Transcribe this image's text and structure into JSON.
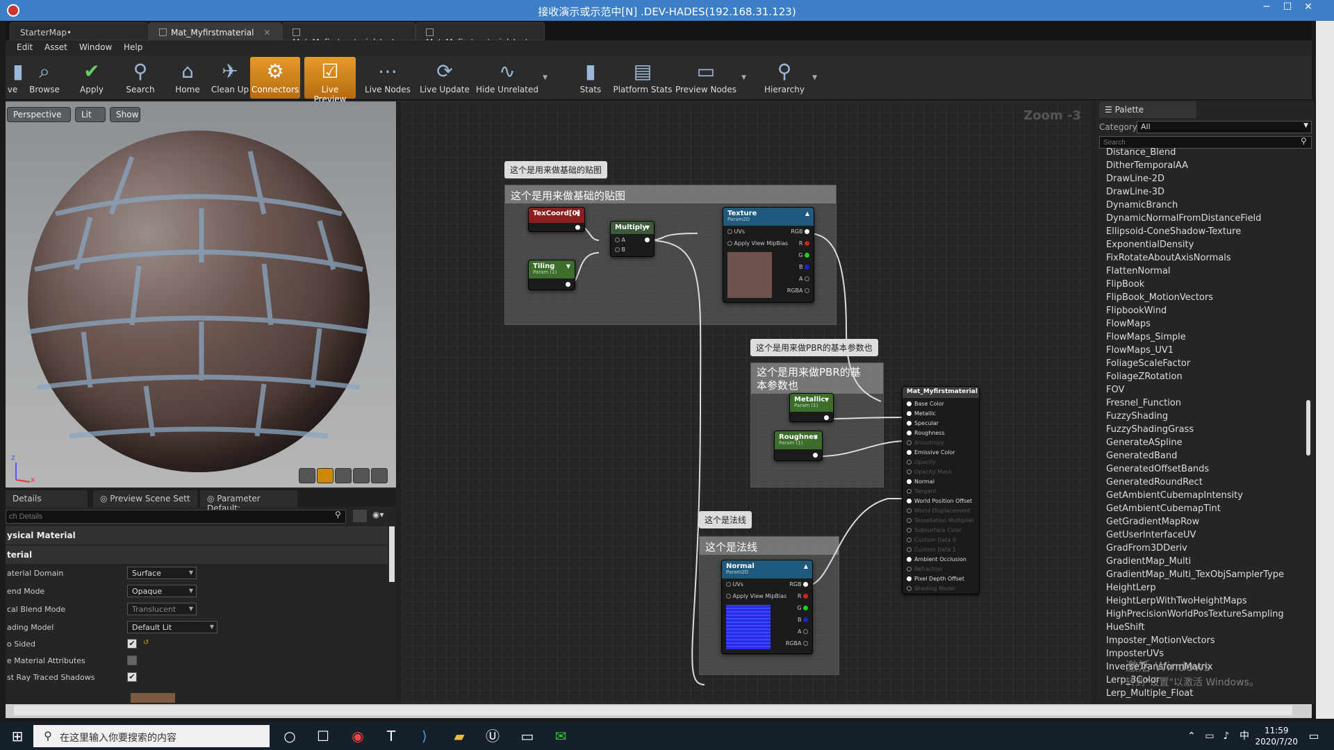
{
  "window": {
    "title": "接收演示或示范中[N] .DEV-HADES(192.168.31.123)",
    "min": "─",
    "max": "☐",
    "close": "✕"
  },
  "tabs": [
    {
      "label": "StarterMap•"
    },
    {
      "label": "Mat_Myfirstmaterial"
    },
    {
      "label": "Mat_Myfirstmaterial_Inst"
    },
    {
      "label": "Mat_Myfirstmaterial_Inst•"
    }
  ],
  "menu": [
    "Edit",
    "Asset",
    "Window",
    "Help"
  ],
  "toolbar": [
    {
      "label": "ve",
      "icon": "save-icon"
    },
    {
      "label": "Browse",
      "icon": "browse-icon"
    },
    {
      "label": "Apply",
      "icon": "apply-check-icon"
    },
    {
      "label": "Search",
      "icon": "search-icon"
    },
    {
      "label": "Home",
      "icon": "home-icon"
    },
    {
      "label": "Clean Up",
      "icon": "cleanup-icon"
    },
    {
      "label": "Connectors",
      "icon": "connectors-icon",
      "active": true
    },
    {
      "label": "Live Preview",
      "icon": "live-preview-icon",
      "active": true
    },
    {
      "label": "Live Nodes",
      "icon": "live-nodes-icon"
    },
    {
      "label": "Live Update",
      "icon": "live-update-icon"
    },
    {
      "label": "Hide Unrelated",
      "icon": "hide-unrelated-icon"
    },
    {
      "label": "Stats",
      "icon": "stats-icon"
    },
    {
      "label": "Platform Stats",
      "icon": "platform-stats-icon"
    },
    {
      "label": "Preview Nodes",
      "icon": "preview-nodes-icon"
    },
    {
      "label": "Hierarchy",
      "icon": "hierarchy-icon"
    }
  ],
  "viewport": {
    "perspective": "Perspective",
    "lit": "Lit",
    "show": "Show",
    "axis_z": "z",
    "axis_x": "x"
  },
  "details": {
    "tabs": [
      "Details",
      "Preview Scene Sett",
      "Parameter Default:"
    ],
    "search_placeholder": "ch Details",
    "cat_physical": "ysical Material",
    "cat_material": "terial",
    "rows": [
      {
        "label": "aterial Domain",
        "value": "Surface"
      },
      {
        "label": "end Mode",
        "value": "Opaque"
      },
      {
        "label": "cal Blend Mode",
        "value": "Translucent"
      },
      {
        "label": "ading Model",
        "value": "Default Lit"
      },
      {
        "label": "o Sided"
      },
      {
        "label": "e Material Attributes"
      },
      {
        "label": "st Ray Traced Shadows"
      }
    ]
  },
  "graph": {
    "zoom": "Zoom -3",
    "comment1": {
      "bubble": "这个是用来做基础的贴图",
      "header": "这个是用来做基础的贴图"
    },
    "comment2": {
      "bubble": "这个是用来做PBR的基本参数也",
      "header_l1": "这个是用来做PBR的基",
      "header_l2": "本参数也"
    },
    "comment3": {
      "bubble": "这个是法线",
      "header": "这个是法线"
    },
    "texcoord": "TexCoord[0]",
    "multiply": "Multiply",
    "mult_a": "A",
    "mult_b": "B",
    "tiling": "Tiling",
    "tiling_sub": "Param (1)",
    "texture": "Texture",
    "texture_sub": "Param2D",
    "uvs": "UVs",
    "apply_mip": "Apply View MipBias",
    "rgb": "RGB",
    "r": "R",
    "g": "G",
    "b": "B",
    "a": "A",
    "rgba": "RGBA",
    "metallic": "Metallic",
    "metallic_sub": "Param (1)",
    "roughness": "Roughnes",
    "roughness_sub": "Param (1)",
    "normal": "Normal",
    "normal_sub": "Param2D",
    "result": "Mat_Myfirstmaterial",
    "result_pins": [
      {
        "label": "Base Color",
        "on": true
      },
      {
        "label": "Metallic",
        "on": true
      },
      {
        "label": "Specular",
        "on": true
      },
      {
        "label": "Roughness",
        "on": true
      },
      {
        "label": "Anisotropy",
        "on": false
      },
      {
        "label": "Emissive Color",
        "on": true
      },
      {
        "label": "Opacity",
        "on": false
      },
      {
        "label": "Opacity Mask",
        "on": false
      },
      {
        "label": "Normal",
        "on": true
      },
      {
        "label": "Tangent",
        "on": false
      },
      {
        "label": "World Position Offset",
        "on": true
      },
      {
        "label": "World Displacement",
        "on": false
      },
      {
        "label": "Tessellation Multiplier",
        "on": false
      },
      {
        "label": "Subsurface Color",
        "on": false
      },
      {
        "label": "Custom Data 0",
        "on": false
      },
      {
        "label": "Custom Data 1",
        "on": false
      },
      {
        "label": "Ambient Occlusion",
        "on": true
      },
      {
        "label": "Refraction",
        "on": false
      },
      {
        "label": "Pixel Depth Offset",
        "on": true
      },
      {
        "label": "Shading Model",
        "on": false
      }
    ]
  },
  "palette": {
    "tab": "Palette",
    "category_label": "Category",
    "category_value": "All",
    "search_placeholder": "Search",
    "items": [
      "Distance_Blend",
      "DitherTemporalAA",
      "DrawLine-2D",
      "DrawLine-3D",
      "DynamicBranch",
      "DynamicNormalFromDistanceField",
      "Ellipsoid-ConeShadow-Texture",
      "ExponentialDensity",
      "FixRotateAboutAxisNormals",
      "FlattenNormal",
      "FlipBook",
      "FlipBook_MotionVectors",
      "FlipbookWind",
      "FlowMaps",
      "FlowMaps_Simple",
      "FlowMaps_UV1",
      "FoliageScaleFactor",
      "FoliageZRotation",
      "FOV",
      "Fresnel_Function",
      "FuzzyShading",
      "FuzzyShadingGrass",
      "GenerateASpline",
      "GeneratedBand",
      "GeneratedOffsetBands",
      "GeneratedRoundRect",
      "GetAmbientCubemapIntensity",
      "GetAmbientCubemapTint",
      "GetGradientMapRow",
      "GetUserInterfaceUV",
      "GradFrom3DDeriv",
      "GradientMap_Multi",
      "GradientMap_Multi_TexObjSamplerType",
      "HeightLerp",
      "HeightLerpWithTwoHeightMaps",
      "HighPrecisionWorldPosTextureSampling",
      "HueShift",
      "Imposter_MotionVectors",
      "ImposterUVs",
      "InverseTransformMatrix",
      "Lerp_3Color",
      "Lerp_Multiple_Float"
    ],
    "watermark1": "激活 Windows",
    "watermark2": "转到\"设置\"以激活 Windows。"
  },
  "taskbar": {
    "search": "在这里输入你要搜索的内容",
    "ime": "中",
    "time": "11:59",
    "date": "2020/7/20"
  }
}
